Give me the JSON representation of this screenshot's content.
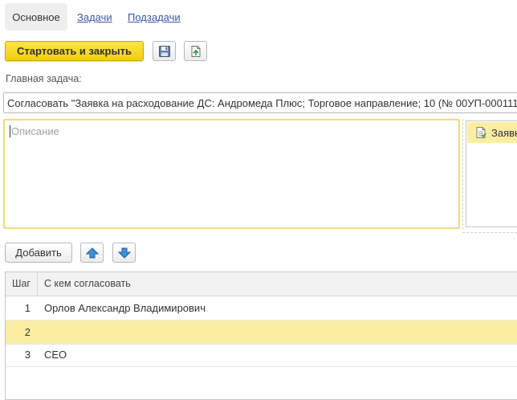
{
  "tabs": [
    {
      "label": "Основное"
    },
    {
      "label": "Задачи"
    },
    {
      "label": "Подзадачи"
    }
  ],
  "toolbar": {
    "start_close_label": "Стартовать и закрыть",
    "save_icon": "floppy-disk-icon",
    "restore_icon": "document-restore-icon"
  },
  "main_task": {
    "label": "Главная задача:",
    "value": "Согласовать \"Заявка на расходование ДС: Андромеда Плюс;  Торговое направление;  10 (№ 00УП-000111"
  },
  "description": {
    "placeholder": "Описание",
    "value": ""
  },
  "side_panel": {
    "item": "Заявка на расходование ДС"
  },
  "list_toolbar": {
    "add_label": "Добавить",
    "up_icon": "arrow-up-icon",
    "down_icon": "arrow-down-icon"
  },
  "table": {
    "columns": [
      "Шаг",
      "С кем согласовать"
    ],
    "rows": [
      {
        "step": "1",
        "who": "Орлов Александр Владимирович"
      },
      {
        "step": "2",
        "who": ""
      },
      {
        "step": "3",
        "who": "CEO"
      }
    ]
  },
  "colors": {
    "accent_yellow": "#f7d92a",
    "selection": "#fbeea2",
    "link": "#3f55a5"
  }
}
